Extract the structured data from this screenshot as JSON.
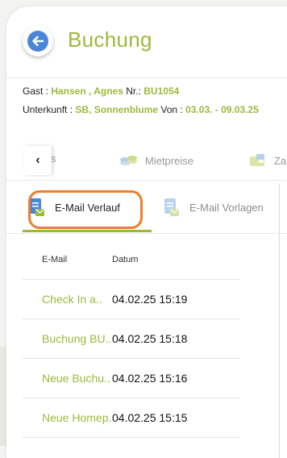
{
  "header": {
    "title": "Buchung"
  },
  "info": {
    "gast_label": "Gast : ",
    "gast_value": "Hansen , Agnes",
    "nr_label": " Nr.: ",
    "nr_value": "BU1054",
    "unterkunft_label": "Unterkunft : ",
    "unterkunft_value": "SB, Sonnenblume",
    "von_label": " Von : ",
    "von_value": "03.03. - 09.03.25"
  },
  "tabs_main": [
    {
      "label": "ls"
    },
    {
      "label": "Mietpreise"
    },
    {
      "label": "Za"
    }
  ],
  "tabs_sub": [
    {
      "label": "E-Mail Verlauf"
    },
    {
      "label": "E-Mail Vorlagen"
    }
  ],
  "table": {
    "headers": [
      "E-Mail",
      "Datum"
    ],
    "rows": [
      {
        "email": "Check In a..",
        "datum": "04.02.25 15:19"
      },
      {
        "email": "Buchung BU..",
        "datum": "04.02.25 15:18"
      },
      {
        "email": "Neue Buchu..",
        "datum": "04.02.25 15:16"
      },
      {
        "email": "Neue Homep..",
        "datum": "04.02.25 15:15"
      }
    ]
  },
  "colors": {
    "accent": "#9bb93e",
    "highlight": "#ef7d2d",
    "back": "#4a86d8"
  }
}
